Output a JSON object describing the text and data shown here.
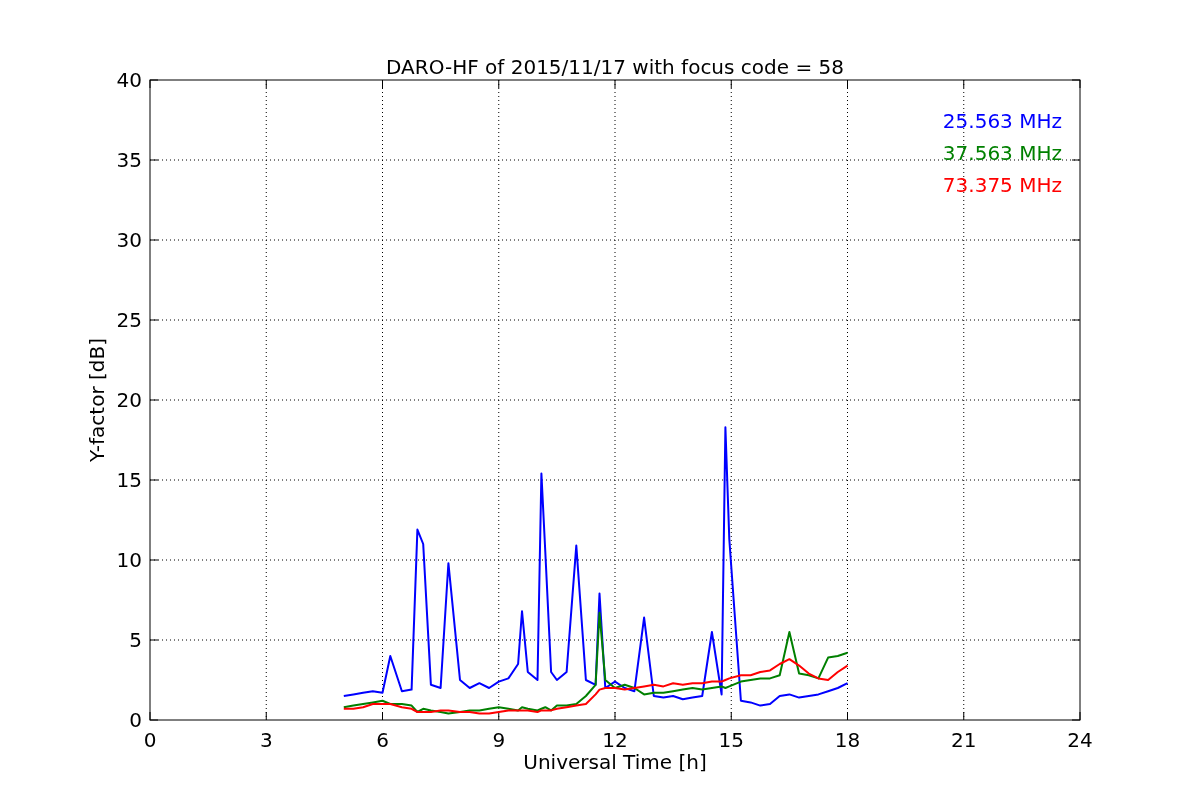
{
  "chart": {
    "chart_data": {
      "type": "line",
      "title": "DARO-HF of 2015/11/17 with focus code = 58",
      "xlabel": "Universal Time [h]",
      "ylabel": "Y-factor [dB]",
      "x": [
        5,
        5.25,
        5.5,
        5.75,
        6,
        6.2,
        6.5,
        6.75,
        6.9,
        7.05,
        7.25,
        7.5,
        7.7,
        8,
        8.25,
        8.5,
        8.75,
        9,
        9.25,
        9.5,
        9.6,
        9.75,
        10,
        10.1,
        10.2,
        10.35,
        10.5,
        10.75,
        11,
        11.25,
        11.5,
        11.6,
        11.75,
        12,
        12.25,
        12.5,
        12.75,
        13,
        13.25,
        13.5,
        13.75,
        14,
        14.25,
        14.5,
        14.75,
        14.85,
        14.95,
        15.25,
        15.5,
        15.75,
        16,
        16.25,
        16.5,
        16.75,
        17,
        17.25,
        17.5,
        17.75,
        18
      ],
      "series": [
        {
          "name": "25.563 MHz",
          "color": "#0000ff",
          "values": [
            1.5,
            1.6,
            1.7,
            1.8,
            1.7,
            4.0,
            1.8,
            1.9,
            11.9,
            11.0,
            2.2,
            2.0,
            9.8,
            2.5,
            2.0,
            2.3,
            2.0,
            2.4,
            2.6,
            3.5,
            6.8,
            3.0,
            2.5,
            15.4,
            10.5,
            3.0,
            2.5,
            3.0,
            10.9,
            2.5,
            2.2,
            7.9,
            2.0,
            2.4,
            2.0,
            1.8,
            6.4,
            1.5,
            1.4,
            1.5,
            1.3,
            1.4,
            1.5,
            5.5,
            1.6,
            18.3,
            11.3,
            1.2,
            1.1,
            0.9,
            1.0,
            1.5,
            1.6,
            1.4,
            1.5,
            1.6,
            1.8,
            2.0,
            2.3
          ]
        },
        {
          "name": "37.563 MHz",
          "color": "#008000",
          "values": [
            0.8,
            0.9,
            1.0,
            1.1,
            1.2,
            1.0,
            1.0,
            0.9,
            0.5,
            0.7,
            0.6,
            0.5,
            0.4,
            0.5,
            0.6,
            0.6,
            0.7,
            0.8,
            0.7,
            0.6,
            0.8,
            0.7,
            0.6,
            0.7,
            0.8,
            0.6,
            0.9,
            0.9,
            1.0,
            1.5,
            2.2,
            6.7,
            2.5,
            2.0,
            2.2,
            2.0,
            1.6,
            1.7,
            1.7,
            1.8,
            1.9,
            2.0,
            1.9,
            2.0,
            2.1,
            2.0,
            2.1,
            2.4,
            2.5,
            2.6,
            2.6,
            2.8,
            5.5,
            2.9,
            2.8,
            2.6,
            3.9,
            4.0,
            4.2
          ]
        },
        {
          "name": "73.375 MHz",
          "color": "#ff0000",
          "values": [
            0.7,
            0.7,
            0.8,
            1.0,
            1.0,
            1.0,
            0.8,
            0.7,
            0.5,
            0.5,
            0.5,
            0.6,
            0.6,
            0.5,
            0.5,
            0.4,
            0.4,
            0.5,
            0.6,
            0.6,
            0.6,
            0.6,
            0.5,
            0.6,
            0.6,
            0.6,
            0.7,
            0.8,
            0.9,
            1.0,
            1.6,
            1.9,
            2.0,
            2.0,
            1.9,
            2.0,
            2.1,
            2.2,
            2.1,
            2.3,
            2.2,
            2.3,
            2.3,
            2.4,
            2.4,
            2.5,
            2.6,
            2.8,
            2.8,
            3.0,
            3.1,
            3.5,
            3.8,
            3.4,
            2.9,
            2.6,
            2.5,
            3.0,
            3.4
          ]
        }
      ],
      "grid": true,
      "xlim": [
        0,
        24
      ],
      "ylim": [
        0,
        40
      ],
      "xticks": [
        0,
        3,
        6,
        9,
        12,
        15,
        18,
        21,
        24
      ],
      "yticks": [
        0,
        5,
        10,
        15,
        20,
        25,
        30,
        35,
        40
      ]
    }
  }
}
